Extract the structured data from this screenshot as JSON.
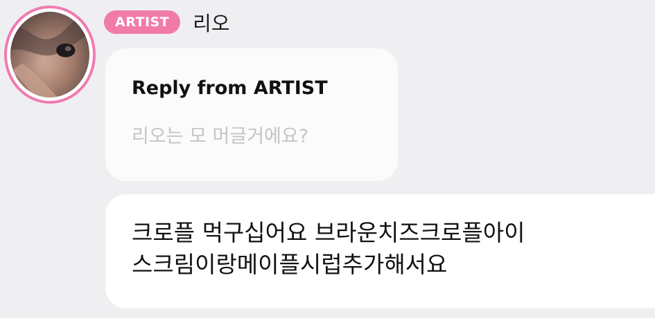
{
  "post": {
    "author_badge": "ARTIST",
    "author_name": "리오",
    "avatar_icon": "profile-photo",
    "accent_color": "#f17ba8"
  },
  "reply": {
    "title": "Reply from ARTIST",
    "quoted_text": "리오는 모 머글거에요?"
  },
  "message": {
    "lines": [
      "크로플 먹구십어요 브라운치즈크로플아이",
      "스크림이랑메이플시럽추가해서요"
    ]
  }
}
